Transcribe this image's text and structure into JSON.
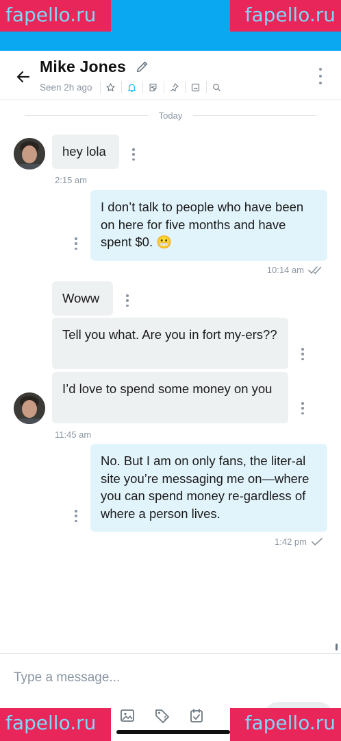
{
  "watermark": {
    "text": "fapello.ru"
  },
  "header": {
    "title": "Mike Jones",
    "seen": "Seen 2h ago"
  },
  "date_separator": "Today",
  "messages": [
    {
      "id": "m1",
      "direction": "incoming",
      "text": "hey lola",
      "time": "2:15 am"
    },
    {
      "id": "m2",
      "direction": "outgoing",
      "text": "I don’t talk to people who have been on here for five months and have spent $0. 😬",
      "time": "10:14 am",
      "status": "read"
    },
    {
      "id": "m3",
      "direction": "incoming",
      "text": "Woww"
    },
    {
      "id": "m4",
      "direction": "incoming",
      "text": "Tell you what. Are you in fort my-ers??"
    },
    {
      "id": "m5",
      "direction": "incoming",
      "text": "I’d love to spend some money on you",
      "time": "11:45 am"
    },
    {
      "id": "m6",
      "direction": "outgoing",
      "text": "No. But I am on only fans, the liter-al site you’re messaging me on—where you can spend money re-gardless of where a person lives.",
      "time": "1:42 pm",
      "status": "sent"
    }
  ],
  "composer": {
    "placeholder": "Type a message..."
  },
  "icons": {
    "header": [
      "back-arrow-icon",
      "pencil-icon",
      "star-icon",
      "bell-icon",
      "notes-icon",
      "pin-icon",
      "image-icon",
      "search-icon",
      "more-vertical-icon"
    ],
    "toolbar": [
      "image-icon",
      "price-tag-icon",
      "calendar-check-icon"
    ]
  },
  "colors": {
    "accent": "#00aff0",
    "incoming_bubble": "#eef1f2",
    "outgoing_bubble": "#e2f4fb",
    "muted": "#8a96a3"
  }
}
